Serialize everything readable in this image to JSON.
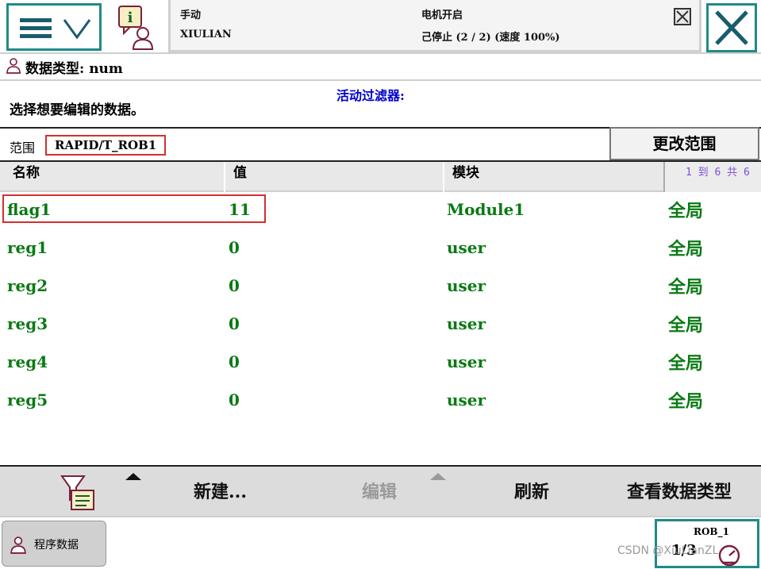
{
  "status": {
    "mode": "手动",
    "controller": "XIULIAN",
    "motor": "电机开启",
    "state": "己停止 (2 / 2) (速度 100%)"
  },
  "header": {
    "data_type_label": "数据类型: num",
    "filter_label": "活动过滤器:",
    "instruction": "选择想要编辑的数据。"
  },
  "scope": {
    "label": "范围",
    "value": "RAPID/T_ROB1",
    "change_button": "更改范围"
  },
  "table": {
    "columns": [
      "名称",
      "值",
      "模块"
    ],
    "pager": "1 到 6 共 6",
    "rows": [
      {
        "name": "flag1",
        "value": "11",
        "module": "Module1",
        "scope": "全局"
      },
      {
        "name": "reg1",
        "value": "0",
        "module": "user",
        "scope": "全局"
      },
      {
        "name": "reg2",
        "value": "0",
        "module": "user",
        "scope": "全局"
      },
      {
        "name": "reg3",
        "value": "0",
        "module": "user",
        "scope": "全局"
      },
      {
        "name": "reg4",
        "value": "0",
        "module": "user",
        "scope": "全局"
      },
      {
        "name": "reg5",
        "value": "0",
        "module": "user",
        "scope": "全局"
      }
    ]
  },
  "toolbar": {
    "new_label": "新建...",
    "edit_label": "编辑",
    "refresh_label": "刷新",
    "view_type_label": "查看数据类型"
  },
  "taskbar": {
    "program_data_label": "程序数据",
    "rob_label": "ROB_1",
    "rob_fraction": "1/3"
  },
  "watermark": "CSDN @XiuLianZL",
  "colors": {
    "accent": "#1f8a8a",
    "data_text": "#0a7a14",
    "filter_text": "#0000cc",
    "highlight": "#d32f2f"
  }
}
